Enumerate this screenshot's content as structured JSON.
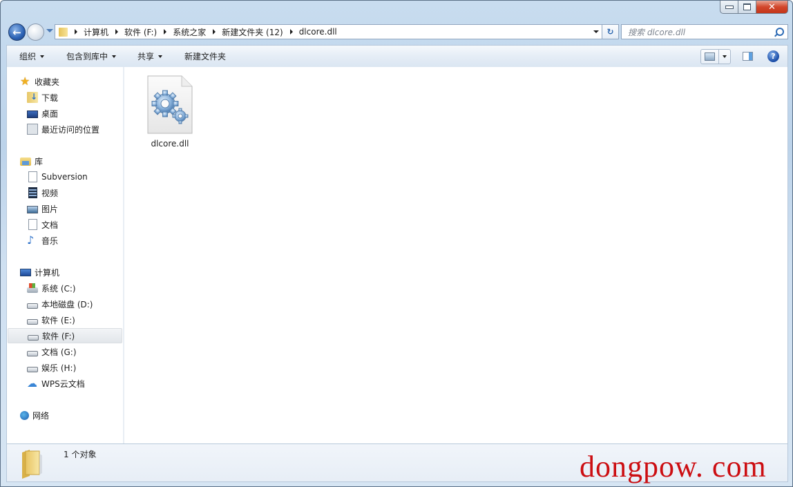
{
  "window": {
    "caption_buttons": {
      "minimize": "minimize",
      "maximize": "maximize",
      "close": "✕"
    }
  },
  "navigation": {
    "back_icon": "back-arrow-icon",
    "breadcrumbs": [
      "计算机",
      "软件 (F:)",
      "系统之家",
      "新建文件夹 (12)",
      "dlcore.dll"
    ],
    "refresh_icon": "↻",
    "search_placeholder": "搜索 dlcore.dll"
  },
  "toolbar": {
    "organize": "组织",
    "include_in_library": "包含到库中",
    "share": "共享",
    "new_folder": "新建文件夹",
    "help": "?"
  },
  "sidebar": {
    "favorites": {
      "label": "收藏夹",
      "items": [
        "下载",
        "桌面",
        "最近访问的位置"
      ]
    },
    "libraries": {
      "label": "库",
      "items": [
        "Subversion",
        "视频",
        "图片",
        "文档",
        "音乐"
      ]
    },
    "computer": {
      "label": "计算机",
      "items": [
        "系统 (C:)",
        "本地磁盘 (D:)",
        "软件 (E:)",
        "软件 (F:)",
        "文档 (G:)",
        "娱乐 (H:)",
        "WPS云文档"
      ],
      "selected": "软件 (F:)"
    },
    "network": {
      "label": "网络"
    }
  },
  "content": {
    "files": [
      {
        "name": "dlcore.dll",
        "icon": "dll-gear-icon"
      }
    ]
  },
  "status": {
    "item_count": "1 个对象"
  },
  "watermark": "dongpow. com"
}
